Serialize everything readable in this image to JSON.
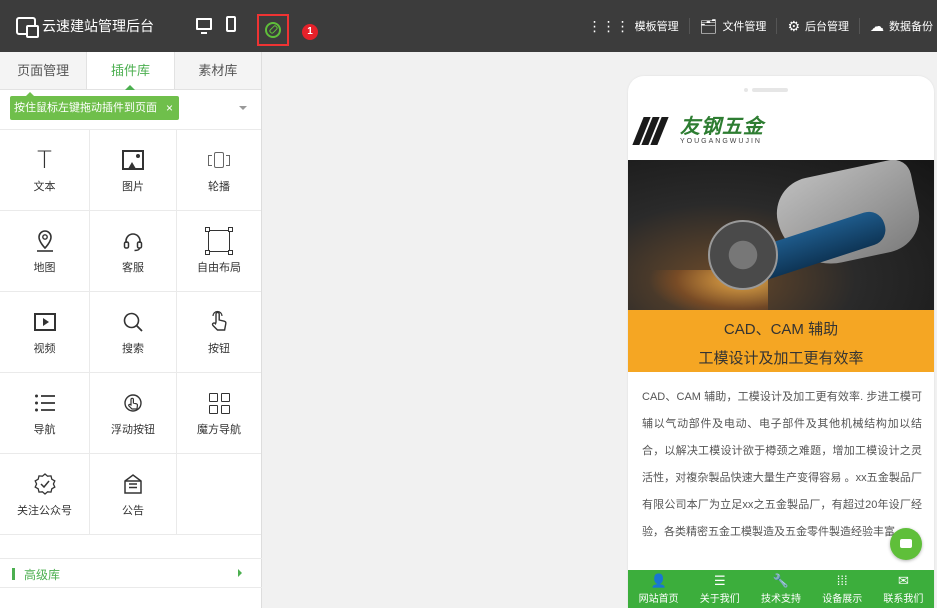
{
  "app": {
    "title": "云速建站管理后台",
    "notification_count": "1"
  },
  "topbar": {
    "menu": [
      {
        "icon": "grid-icon",
        "label": "模板管理"
      },
      {
        "icon": "file-icon",
        "label": "文件管理"
      },
      {
        "icon": "gear-icon",
        "label": "后台管理"
      },
      {
        "icon": "cloud-upload-icon",
        "label": "数据备份"
      }
    ]
  },
  "leftpanel": {
    "tabs": [
      "页面管理",
      "插件库",
      "素材库"
    ],
    "active_tab": "插件库",
    "tip": "按住鼠标左键拖动插件到页面",
    "tip_close": "×",
    "plugins": [
      {
        "icon": "text-icon",
        "label": "文本"
      },
      {
        "icon": "image-icon",
        "label": "图片"
      },
      {
        "icon": "carousel-icon",
        "label": "轮播"
      },
      {
        "icon": "map-pin-icon",
        "label": "地图"
      },
      {
        "icon": "headset-icon",
        "label": "客服"
      },
      {
        "icon": "free-layout-icon",
        "label": "自由布局"
      },
      {
        "icon": "video-icon",
        "label": "视频"
      },
      {
        "icon": "search-icon",
        "label": "搜索"
      },
      {
        "icon": "pointer-icon",
        "label": "按钮"
      },
      {
        "icon": "list-icon",
        "label": "导航"
      },
      {
        "icon": "floating-button-icon",
        "label": "浮动按钮"
      },
      {
        "icon": "magic-nav-icon",
        "label": "魔方导航"
      },
      {
        "icon": "badge-check-icon",
        "label": "关注公众号"
      },
      {
        "icon": "announcement-icon",
        "label": "公告"
      }
    ],
    "advanced_label": "高级库"
  },
  "preview": {
    "logo_cn": "友钢五金",
    "logo_en": "YOUGANGWUJIN",
    "banner_line1": "CAD、CAM 辅助",
    "banner_line2": "工模设计及加工更有效率",
    "body_text": "CAD、CAM 辅助，工模设计及加工更有效率. 步进工模可辅以气动部件及电动、电子部件及其他机械结构加以结合，以解决工模设计欲于樽颈之难题，增加工模设计之灵活性，对複杂製品快速大量生产变得容易 。xx五金製品厂有限公司本厂为立足xx之五金製品厂，有超过20年设厂经验，各类精密五金工模製造及五金零件製造经验丰富",
    "bottom_nav": [
      {
        "icon": "user-icon",
        "label": "网站首页"
      },
      {
        "icon": "list-icon",
        "label": "关于我们"
      },
      {
        "icon": "wrench-icon",
        "label": "技术支持"
      },
      {
        "icon": "grid-icon",
        "label": "设备展示"
      },
      {
        "icon": "mail-icon",
        "label": "联系我们"
      }
    ]
  },
  "colors": {
    "topbar": "#3c3c3c",
    "accent_green": "#4caf50",
    "banner_orange": "#f5a623",
    "badge_red": "#e6212a",
    "nav_green": "#3cae3c"
  }
}
